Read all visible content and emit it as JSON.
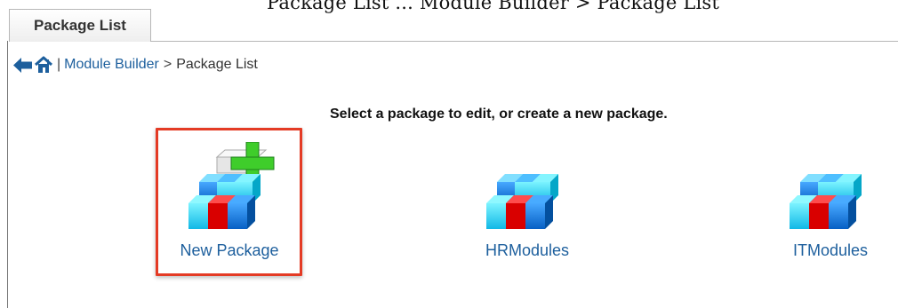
{
  "cutoff_text": "Package List ... Module Builder > Package List",
  "tabs": [
    {
      "label": "Package List"
    }
  ],
  "breadcrumb": {
    "back_icon": "back-arrow-icon",
    "home_icon": "home-icon",
    "separator": "|",
    "module_builder_label": "Module Builder",
    "arrow": ">",
    "current": "Package List"
  },
  "instruction": "Select a package to edit, or create a new package.",
  "packages": [
    {
      "label": "New Package",
      "icon": "new-package-icon"
    },
    {
      "label": "HRModules",
      "icon": "package-blocks-icon"
    },
    {
      "label": "ITModules",
      "icon": "package-blocks-icon"
    }
  ],
  "colors": {
    "link": "#1d5f9d",
    "highlight": "#e43b25",
    "tab_border": "#b7b7b7",
    "block_blue": "#1f77d6",
    "block_cyan": "#2fd7f7",
    "block_red": "#d90000",
    "plus_green": "#41d62f"
  }
}
